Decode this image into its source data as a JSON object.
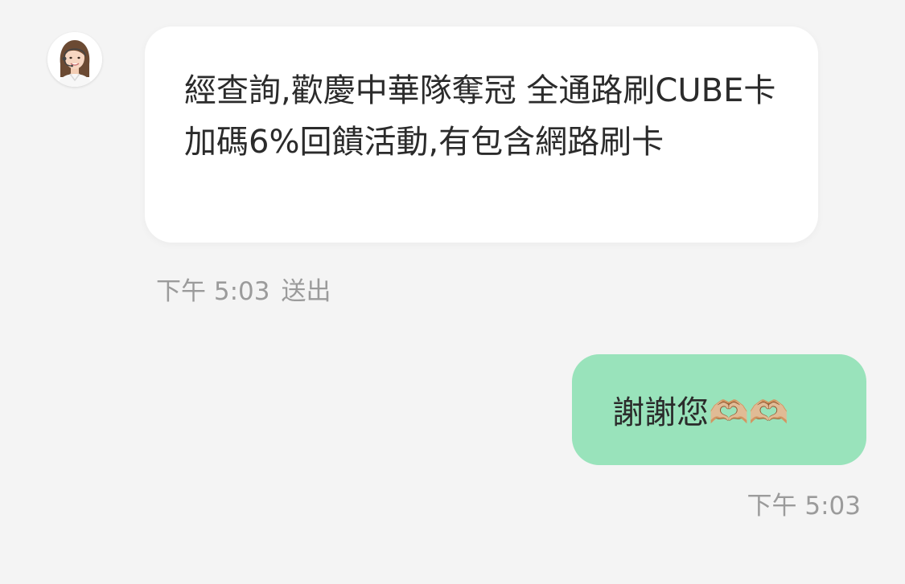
{
  "incoming": {
    "avatar_icon": "agent-avatar-icon",
    "message": "經查詢,歡慶中華隊奪冠 全通路刷CUBE卡加碼6%回饋活動,有包含網路刷卡",
    "time": "下午 5:03",
    "status": "送出",
    "bubble_color": "#ffffff"
  },
  "outgoing": {
    "message": "謝謝您🫶🏼🫶🏼",
    "time": "下午 5:03",
    "bubble_color": "#99e3bb"
  },
  "colors": {
    "background": "#f4f4f4",
    "meta_text": "#9b9b9b",
    "message_text": "#2b2b2b"
  }
}
